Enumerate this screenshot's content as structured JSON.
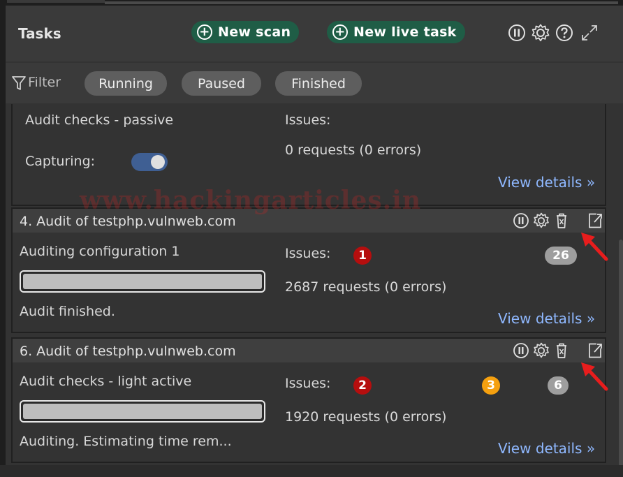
{
  "header": {
    "title": "Tasks",
    "new_scan_label": "New scan",
    "new_live_task_label": "New live task"
  },
  "filter": {
    "label": "Filter",
    "chips": [
      "Running",
      "Paused",
      "Finished"
    ]
  },
  "watermark": "www.hackingarticles.in",
  "cards": [
    {
      "name": "Audit checks - passive",
      "issues_label": "Issues:",
      "requests": "0 requests (0 errors)",
      "capturing_label": "Capturing:",
      "capturing_on": true,
      "view_details": "View details"
    },
    {
      "title": "4. Audit of testphp.vulnweb.com",
      "status": "Auditing configuration 1",
      "issues_label": "Issues:",
      "badge_high": "1",
      "badge_info": "26",
      "requests": "2687 requests (0 errors)",
      "progress": 1.0,
      "footer": "Audit finished.",
      "view_details": "View details"
    },
    {
      "title": "6. Audit of testphp.vulnweb.com",
      "status": "Audit checks - light active",
      "issues_label": "Issues:",
      "badge_high": "2",
      "badge_medium": "3",
      "badge_info": "6",
      "requests": "1920 requests (0 errors)",
      "progress": 1.0,
      "footer": "Auditing. Estimating time rem...",
      "view_details": "View details"
    }
  ],
  "colors": {
    "high": "#b50e0e",
    "medium": "#f5a00f",
    "info": "#9e9e9e",
    "accent": "#1f5d46",
    "link": "#8fb8ff",
    "arrow": "#e81d1d"
  },
  "icons": [
    "pause-icon",
    "settings-icon",
    "help-icon",
    "expand-icon",
    "filter-icon",
    "trash-icon",
    "open-external-icon",
    "plus-icon",
    "chevron-double-right-icon"
  ]
}
